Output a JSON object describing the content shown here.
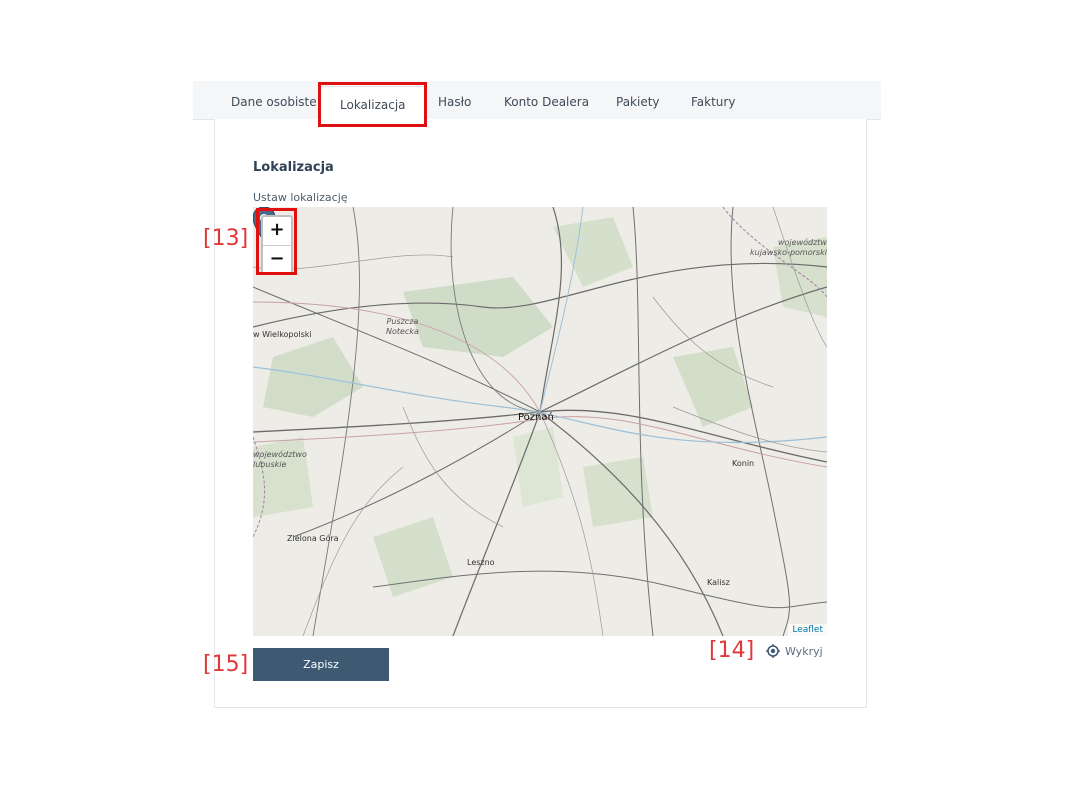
{
  "tabs": [
    {
      "label": "Dane osobiste"
    },
    {
      "label": "Lokalizacja",
      "active": true
    },
    {
      "label": "Hasło"
    },
    {
      "label": "Konto Dealera"
    },
    {
      "label": "Pakiety"
    },
    {
      "label": "Faktury"
    }
  ],
  "section": {
    "title": "Lokalizacja",
    "field_label": "Ustaw lokalizację"
  },
  "map": {
    "zoom_in": "+",
    "zoom_out": "−",
    "attribution": "Leaflet",
    "labels": {
      "woj_kp": "województwo\nkujawsko-pomorskie",
      "wielkopolski": "w Wielkopolski",
      "puszcza": "Puszcza\nNotecka",
      "poznan": "Poznań",
      "woj_lub": "województwo\nlubuskie",
      "konin": "Konin",
      "zielona": "Zielona Góra",
      "leszno": "Leszno",
      "kalisz": "Kalisz"
    }
  },
  "actions": {
    "save_label": "Zapisz",
    "detect_label": "Wykryj"
  },
  "annotations": {
    "zoom_tag": "[13]",
    "detect_tag": "[14]",
    "save_tag": "[15]"
  },
  "colors": {
    "accent": "#3e5a73",
    "highlight": "#e01010",
    "marker": "#4a6a8a"
  }
}
